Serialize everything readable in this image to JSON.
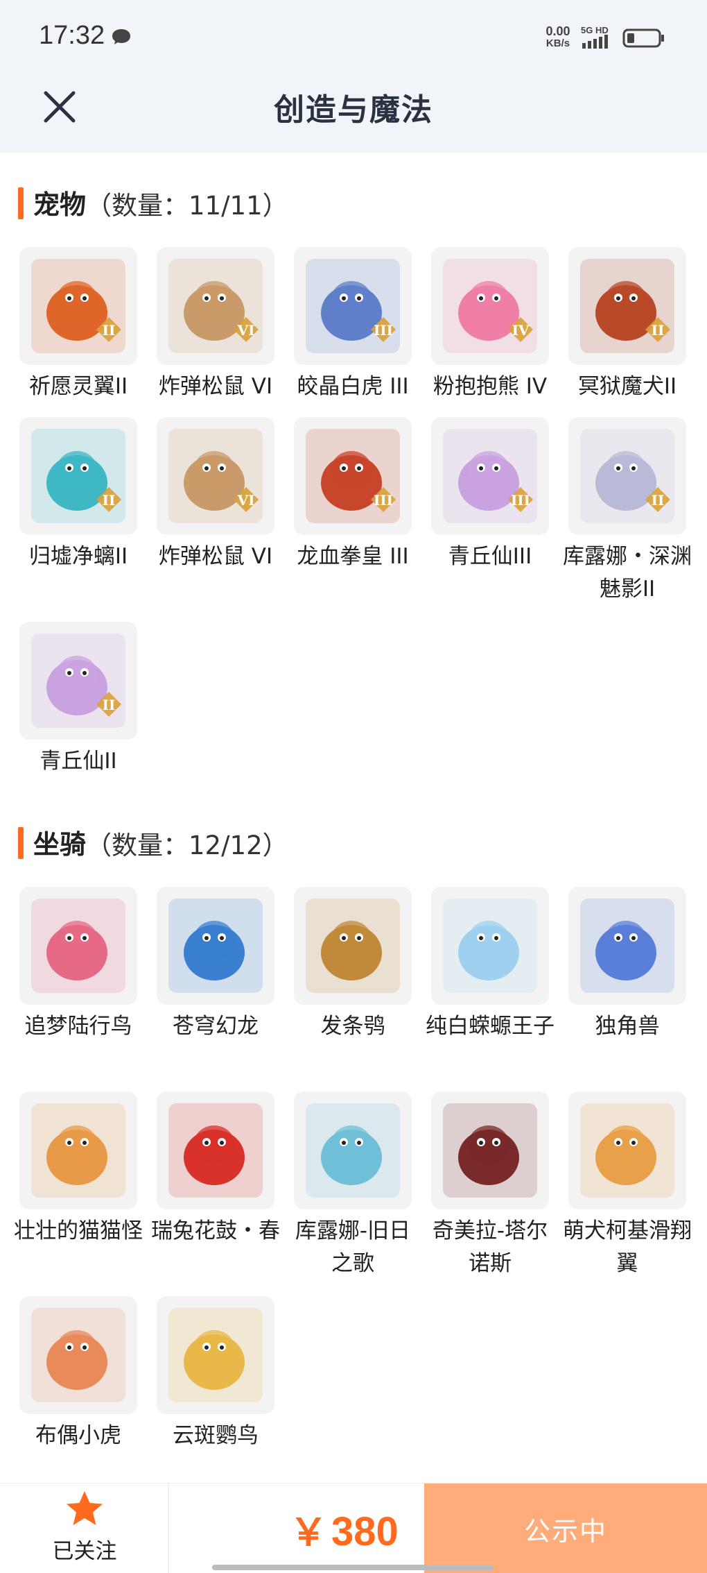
{
  "status_bar": {
    "time": "17:32",
    "net_speed_value": "0.00",
    "net_speed_unit": "KB/s",
    "network_label": "5G HD",
    "icons": [
      "chat-bubble-icon",
      "signal-icon",
      "battery-icon"
    ]
  },
  "header": {
    "title": "创造与魔法",
    "close_icon": "close-icon"
  },
  "pets": {
    "title": "宠物",
    "count": "（数量：11/11）",
    "items": [
      {
        "name": "祈愿灵翼II",
        "badge": "II",
        "color": "#e0652a"
      },
      {
        "name": "炸弹松鼠 VI",
        "badge": "VI",
        "color": "#c99a6a"
      },
      {
        "name": "皎晶白虎 III",
        "badge": "III",
        "color": "#5f7fc9"
      },
      {
        "name": "粉抱抱熊 IV",
        "badge": "IV",
        "color": "#f07fa8"
      },
      {
        "name": "冥狱魔犬II",
        "badge": "II",
        "color": "#b84a2a"
      },
      {
        "name": "归墟净螭II",
        "badge": "II",
        "color": "#3fb8c4"
      },
      {
        "name": "炸弹松鼠 VI",
        "badge": "VI",
        "color": "#c99a6a"
      },
      {
        "name": "龙血拳皇 III",
        "badge": "III",
        "color": "#c8462c"
      },
      {
        "name": "青丘仙III",
        "badge": "III",
        "color": "#c9a3e0"
      },
      {
        "name": "库露娜・深渊魅影II",
        "badge": "II",
        "color": "#b9b9d8"
      },
      {
        "name": "青丘仙II",
        "badge": "II",
        "color": "#c9a3e0"
      }
    ]
  },
  "mounts": {
    "title": "坐骑",
    "count": "（数量：12/12）",
    "items": [
      {
        "name": "追梦陆行鸟",
        "color": "#e56a86"
      },
      {
        "name": "苍穹幻龙",
        "color": "#3a7fd0"
      },
      {
        "name": "发条鸮",
        "color": "#c08a3a"
      },
      {
        "name": "纯白蝾螈王子",
        "color": "#9fd0f0"
      },
      {
        "name": "独角兽",
        "color": "#5a7fd8"
      },
      {
        "name": "壮壮的猫猫怪",
        "color": "#e89a4a"
      },
      {
        "name": "瑞兔花鼓・春",
        "color": "#d8322a"
      },
      {
        "name": "库露娜-旧日之歌",
        "color": "#6fbfd8"
      },
      {
        "name": "奇美拉-塔尔诺斯",
        "color": "#7a2a2a"
      },
      {
        "name": "萌犬柯基滑翔翼",
        "color": "#e8a04a"
      },
      {
        "name": "布偶小虎",
        "color": "#e88a5a"
      },
      {
        "name": "云斑鹦鸟",
        "color": "#e8b84a"
      }
    ]
  },
  "bottom_bar": {
    "follow_label": "已关注",
    "follow_icon": "star-icon",
    "currency": "￥",
    "price": "380",
    "status_button": "公示中"
  },
  "colors": {
    "accent": "#ff6a1f",
    "button_bg": "#ffab7a",
    "header_bg": "#f1f4f8"
  }
}
